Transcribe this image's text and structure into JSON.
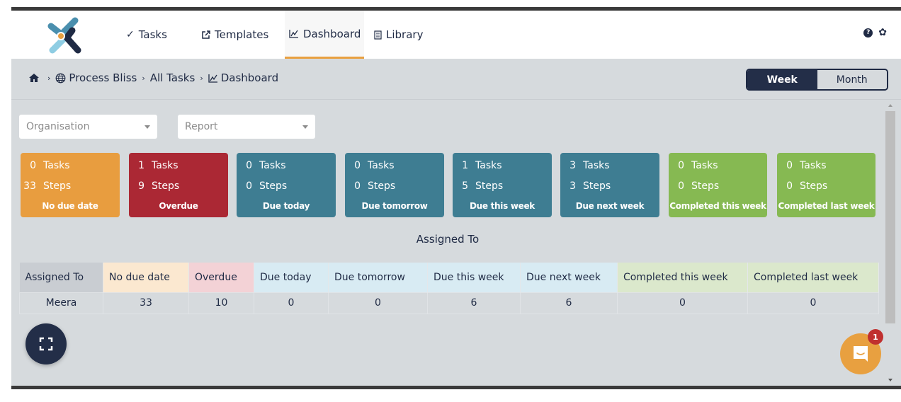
{
  "nav": {
    "items": [
      {
        "label": "Tasks",
        "icon": "check-icon"
      },
      {
        "label": "Templates",
        "icon": "external-link-icon"
      },
      {
        "label": "Dashboard",
        "icon": "line-chart-icon",
        "active": true
      },
      {
        "label": "Library",
        "icon": "document-icon"
      }
    ],
    "help_icon": "help-icon",
    "settings_icon": "gear-icon"
  },
  "breadcrumb": {
    "items": [
      {
        "label": "",
        "icon": "home-icon"
      },
      {
        "label": "Process Bliss",
        "icon": "globe-icon"
      },
      {
        "label": "All Tasks"
      },
      {
        "label": "Dashboard",
        "icon": "line-chart-icon"
      }
    ]
  },
  "period_toggle": {
    "options": [
      "Week",
      "Month"
    ],
    "selected": "Week"
  },
  "filters": {
    "organisation": {
      "placeholder": "Organisation",
      "value": ""
    },
    "report": {
      "placeholder": "Report",
      "value": ""
    }
  },
  "cards": [
    {
      "tasks": "0",
      "steps": "33",
      "label": "No due date",
      "color": "#e89d3f"
    },
    {
      "tasks": "1",
      "steps": "9",
      "label": "Overdue",
      "color": "#ab2834"
    },
    {
      "tasks": "0",
      "steps": "0",
      "label": "Due today",
      "color": "#3e7d92"
    },
    {
      "tasks": "0",
      "steps": "0",
      "label": "Due tomorrow",
      "color": "#3e7d92"
    },
    {
      "tasks": "1",
      "steps": "5",
      "label": "Due this week",
      "color": "#3e7d92"
    },
    {
      "tasks": "3",
      "steps": "3",
      "label": "Due next week",
      "color": "#3e7d92"
    },
    {
      "tasks": "0",
      "steps": "0",
      "label": "Completed this week",
      "color": "#86b952"
    },
    {
      "tasks": "0",
      "steps": "0",
      "label": "Completed last week",
      "color": "#86b952"
    }
  ],
  "card_units": {
    "tasks": "Tasks",
    "steps": "Steps"
  },
  "assigned_table": {
    "title": "Assigned To",
    "columns": [
      {
        "label": "Assigned To",
        "bg": "#c9cdd2"
      },
      {
        "label": "No due date",
        "bg": "#fbe8d0"
      },
      {
        "label": "Overdue",
        "bg": "#f3d2d6"
      },
      {
        "label": "Due today",
        "bg": "#d8ebf3"
      },
      {
        "label": "Due tomorrow",
        "bg": "#d8ebf3"
      },
      {
        "label": "Due this week",
        "bg": "#d8ebf3"
      },
      {
        "label": "Due next week",
        "bg": "#d8ebf3"
      },
      {
        "label": "Completed this week",
        "bg": "#dbe8cc"
      },
      {
        "label": "Completed last week",
        "bg": "#dbe8cc"
      }
    ],
    "rows": [
      [
        "Meera",
        "33",
        "10",
        "0",
        "0",
        "6",
        "6",
        "0",
        "0"
      ]
    ]
  },
  "chat": {
    "badge_count": "1"
  },
  "colors": {
    "accent": "#e8a040",
    "navy": "#232e48"
  }
}
